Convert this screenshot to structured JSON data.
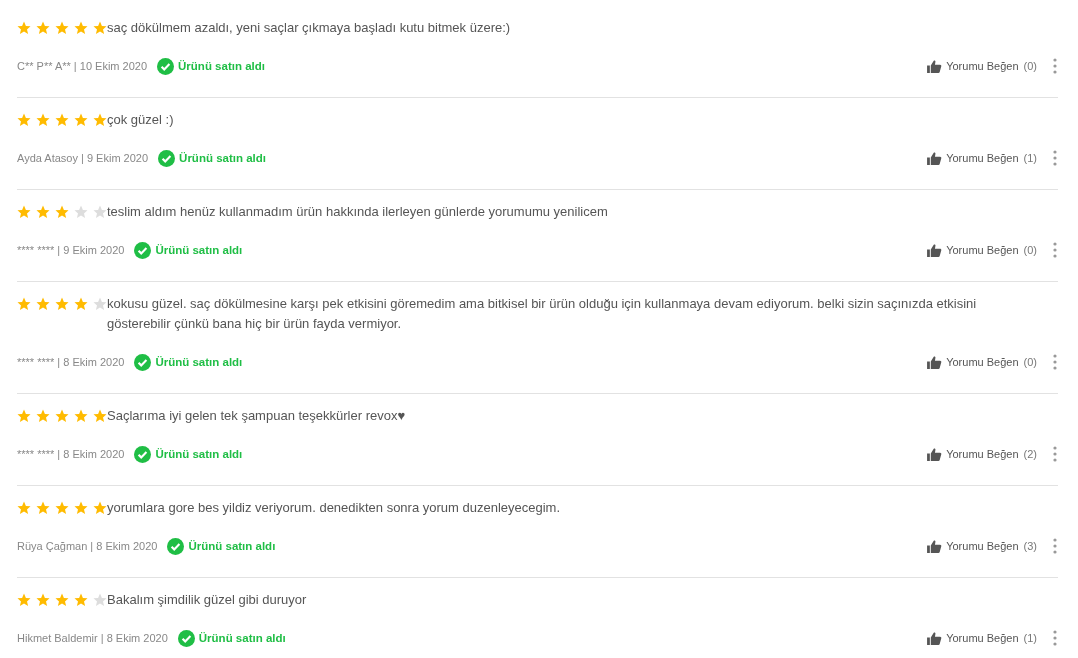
{
  "reviews": [
    {
      "stars": 5,
      "text": "saç dökülmem azaldı, yeni saçlar çıkmaya başladı kutu bitmek üzere:)",
      "meta": "C** P** A** | 10 Ekim 2020",
      "verified": true,
      "badge": "Ürünü satın aldı",
      "like": "Yorumu Beğen",
      "count": "(0)"
    },
    {
      "stars": 5,
      "text": "çok güzel :)",
      "meta": "Ayda Atasoy | 9 Ekim 2020",
      "verified": true,
      "badge": "Ürünü satın aldı",
      "like": "Yorumu Beğen",
      "count": "(1)"
    },
    {
      "stars": 3,
      "text": "teslim aldım henüz kullanmadım ürün hakkında ilerleyen günlerde yorumumu yenilicem",
      "meta": "**** **** | 9 Ekim 2020",
      "verified": true,
      "badge": "Ürünü satın aldı",
      "like": "Yorumu Beğen",
      "count": "(0)"
    },
    {
      "stars": 4,
      "text": "kokusu güzel. saç dökülmesine karşı pek etkisini göremedim ama bitkisel bir ürün olduğu için kullanmaya devam ediyorum. belki sizin saçınızda etkisini gösterebilir çünkü bana hiç bir ürün fayda vermiyor.",
      "meta": "**** **** | 8 Ekim 2020",
      "verified": true,
      "badge": "Ürünü satın aldı",
      "like": "Yorumu Beğen",
      "count": "(0)"
    },
    {
      "stars": 5,
      "text": "Saçlarıma iyi gelen tek şampuan teşekkürler revox♥",
      "meta": "**** **** | 8 Ekim 2020",
      "verified": true,
      "badge": "Ürünü satın aldı",
      "like": "Yorumu Beğen",
      "count": "(2)"
    },
    {
      "stars": 5,
      "text": "yorumlara gore bes yildiz veriyorum. denedikten sonra yorum duzenleyecegim.",
      "meta": "Rüya Çağman | 8 Ekim 2020",
      "verified": true,
      "badge": "Ürünü satın aldı",
      "like": "Yorumu Beğen",
      "count": "(3)"
    },
    {
      "stars": 4,
      "text": "Bakalım şimdilik güzel gibi duruyor",
      "meta": "Hikmet Baldemir | 8 Ekim 2020",
      "verified": true,
      "badge": "Ürünü satın aldı",
      "like": "Yorumu Beğen",
      "count": "(1)"
    }
  ]
}
